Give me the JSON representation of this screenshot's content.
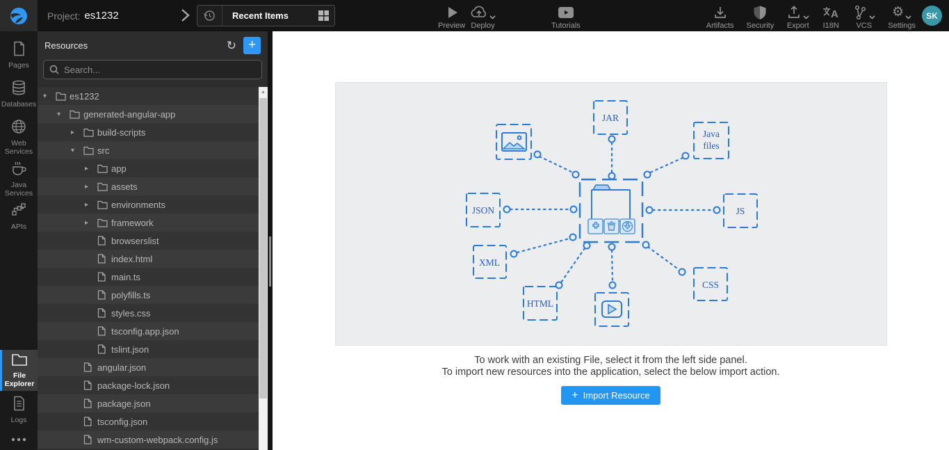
{
  "header": {
    "project_label": "Project:",
    "project_name": "es1232",
    "recent_items_label": "Recent Items",
    "toolbar_center": [
      {
        "label": "Preview",
        "icon": "play-icon",
        "has_caret": false
      },
      {
        "label": "Deploy",
        "icon": "cloud-upload-icon",
        "has_caret": true
      },
      {
        "label": "Tutorials",
        "icon": "video-play-icon",
        "has_caret": false
      }
    ],
    "toolbar_right": [
      {
        "label": "Artifacts",
        "icon": "download-tray-icon",
        "has_caret": false
      },
      {
        "label": "Security",
        "icon": "shield-icon",
        "has_caret": false
      },
      {
        "label": "Export",
        "icon": "upload-tray-icon",
        "has_caret": true
      },
      {
        "label": "I18N",
        "icon": "translate-icon",
        "has_caret": false
      },
      {
        "label": "VCS",
        "icon": "git-branch-icon",
        "has_caret": true
      },
      {
        "label": "Settings",
        "icon": "gear-icon",
        "has_caret": true
      }
    ],
    "avatar_initials": "SK"
  },
  "rail": {
    "items": [
      {
        "label": "Pages",
        "icon": "page-icon",
        "active": false
      },
      {
        "label": "Databases",
        "icon": "database-icon",
        "active": false
      },
      {
        "label": "Web Services",
        "icon": "globe-icon",
        "active": false
      },
      {
        "label": "Java Services",
        "icon": "coffee-icon",
        "active": false
      },
      {
        "label": "APIs",
        "icon": "api-nodes-icon",
        "active": false
      },
      {
        "label": "File Explorer",
        "icon": "folder-icon",
        "active": true
      },
      {
        "label": "Logs",
        "icon": "log-file-icon",
        "active": false
      }
    ],
    "more_icon": "ellipsis-icon"
  },
  "resources_panel": {
    "title": "Resources",
    "search_placeholder": "Search...",
    "tree": [
      {
        "label": "es1232",
        "type": "folder",
        "state": "expanded",
        "level": 0
      },
      {
        "label": "generated-angular-app",
        "type": "folder",
        "state": "expanded",
        "level": 1
      },
      {
        "label": "build-scripts",
        "type": "folder",
        "state": "collapsed",
        "level": 2
      },
      {
        "label": "src",
        "type": "folder",
        "state": "expanded",
        "level": 2
      },
      {
        "label": "app",
        "type": "folder",
        "state": "collapsed",
        "level": 3
      },
      {
        "label": "assets",
        "type": "folder",
        "state": "collapsed",
        "level": 3
      },
      {
        "label": "environments",
        "type": "folder",
        "state": "collapsed",
        "level": 3
      },
      {
        "label": "framework",
        "type": "folder",
        "state": "collapsed",
        "level": 3
      },
      {
        "label": "browserslist",
        "type": "file",
        "state": "none",
        "level": 3
      },
      {
        "label": "index.html",
        "type": "file",
        "state": "none",
        "level": 3
      },
      {
        "label": "main.ts",
        "type": "file",
        "state": "none",
        "level": 3
      },
      {
        "label": "polyfills.ts",
        "type": "file",
        "state": "none",
        "level": 3
      },
      {
        "label": "styles.css",
        "type": "file",
        "state": "none",
        "level": 3
      },
      {
        "label": "tsconfig.app.json",
        "type": "file",
        "state": "none",
        "level": 3
      },
      {
        "label": "tslint.json",
        "type": "file",
        "state": "none",
        "level": 3
      },
      {
        "label": "angular.json",
        "type": "file",
        "state": "none",
        "level": 2
      },
      {
        "label": "package-lock.json",
        "type": "file",
        "state": "none",
        "level": 2
      },
      {
        "label": "package.json",
        "type": "file",
        "state": "none",
        "level": 2
      },
      {
        "label": "tsconfig.json",
        "type": "file",
        "state": "none",
        "level": 2
      },
      {
        "label": "wm-custom-webpack.config.js",
        "type": "file",
        "state": "none",
        "level": 2
      }
    ]
  },
  "main": {
    "diagram": {
      "labels": {
        "jar": "JAR",
        "java_line1": "Java",
        "java_line2": "files",
        "json": "JSON",
        "js": "JS",
        "xml": "XML",
        "css": "CSS",
        "html": "HTML"
      },
      "icon_nodes": [
        "image-file-icon",
        "video-file-icon",
        "central-folder-icon"
      ],
      "central_actions": [
        "add-icon",
        "delete-icon",
        "download-icon"
      ]
    },
    "instructions_line1": "To work with an existing File, select it from the left side panel.",
    "instructions_line2": "To import new resources into the application, select the below import action.",
    "import_button_label": "Import Resource"
  },
  "colors": {
    "accent_blue": "#2f97f4",
    "import_button_blue": "#2196f3",
    "diagram_blue": "#2b7ad8",
    "diagram_label_blue": "#2a5cb8",
    "diagram_bg": "#ebedef",
    "header_bg": "#141414",
    "panel_bg": "#2d2d2d",
    "avatar_teal": "#3898a8"
  }
}
